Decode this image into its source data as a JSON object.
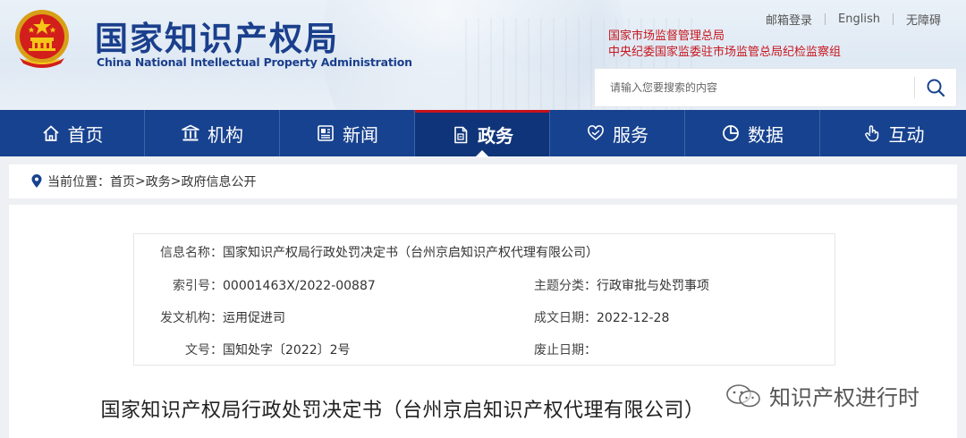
{
  "header": {
    "title_cn": "国家知识产权局",
    "title_en": "China National Intellectual Property Administration",
    "top_links": [
      "邮箱登录",
      "English",
      "无障碍"
    ],
    "org_links": [
      "国家市场监督管理总局",
      "中央纪委国家监委驻市场监管总局纪检监察组"
    ],
    "search_placeholder": "请输入您要搜索的内容",
    "colors": {
      "brand_blue": "#1a3f8c",
      "red": "#c8161d"
    }
  },
  "nav": {
    "items": [
      {
        "label": "首页",
        "icon": "home-icon"
      },
      {
        "label": "机构",
        "icon": "building-icon"
      },
      {
        "label": "新闻",
        "icon": "newspaper-icon"
      },
      {
        "label": "政务",
        "icon": "document-icon",
        "active": true
      },
      {
        "label": "服务",
        "icon": "heart-hand-icon"
      },
      {
        "label": "数据",
        "icon": "pie-chart-icon"
      },
      {
        "label": "互动",
        "icon": "hand-pointer-icon"
      }
    ],
    "colors": {
      "bg": "#17428f",
      "active_bg": "#0f3479",
      "active_accent": "#c4121a"
    }
  },
  "breadcrumb": {
    "prefix": "当前位置：",
    "items": [
      "首页",
      "政务",
      "政府信息公开"
    ],
    "separator": ">"
  },
  "meta": {
    "info_name_label": "信息名称：",
    "info_name": "国家知识产权局行政处罚决定书（台州京启知识产权代理有限公司）",
    "index_label": "索引号：",
    "index": "00001463X/2022-00887",
    "topic_label": "主题分类：",
    "topic": "行政审批与处罚事项",
    "issuer_label": "发文机构：",
    "issuer": "运用促进司",
    "date_label": "成文日期：",
    "date": "2022-12-28",
    "doc_no_label": "文号：",
    "doc_no": "国知处字〔2022〕2号",
    "abolish_label": "废止日期：",
    "abolish": ""
  },
  "document": {
    "title": "国家知识产权局行政处罚决定书（台州京启知识产权代理有限公司）"
  },
  "watermark": {
    "text": "知识产权进行时"
  }
}
